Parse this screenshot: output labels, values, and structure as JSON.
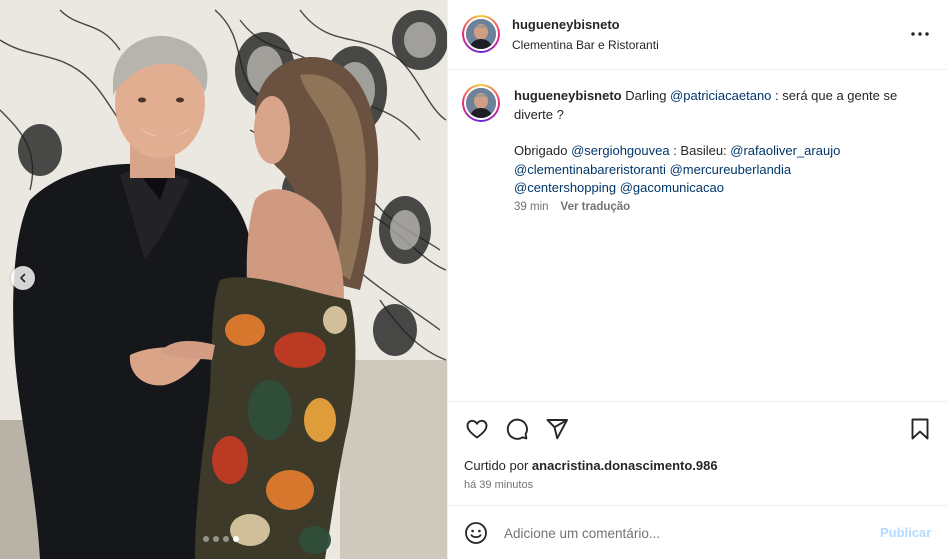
{
  "post": {
    "username": "hugueneybisneto",
    "location": "Clementina Bar e Ristoranti",
    "carousel": {
      "count": 4,
      "active_index": 3
    }
  },
  "caption": {
    "username": "hugueneybisneto",
    "text_1": " Darling ",
    "mention_1": "@patriciacaetano",
    "text_2": " : será que a gente se diverte ?",
    "text_3": "Obrigado ",
    "mention_2": "@sergiohgouvea",
    "text_4": " : Basileu: ",
    "mention_3": "@rafaoliver_araujo",
    "mention_4": "@clementinabareristoranti",
    "mention_5": "@mercureuberlandia",
    "mention_6": "@centershopping",
    "mention_7": "@gacomunicacao",
    "time": "39 min",
    "translate_label": "Ver tradução"
  },
  "actions": {
    "like_icon": "heart-icon",
    "comment_icon": "comment-icon",
    "share_icon": "send-icon",
    "save_icon": "bookmark-icon"
  },
  "likes": {
    "prefix": "Curtido por ",
    "user": "anacristina.donascimento.986"
  },
  "posted_time": "há 39 minutos",
  "comment_box": {
    "placeholder": "Adicione um comentário...",
    "publish_label": "Publicar"
  },
  "colors": {
    "link": "#00376b",
    "muted": "#737373",
    "publish_disabled": "#b3dbff"
  }
}
